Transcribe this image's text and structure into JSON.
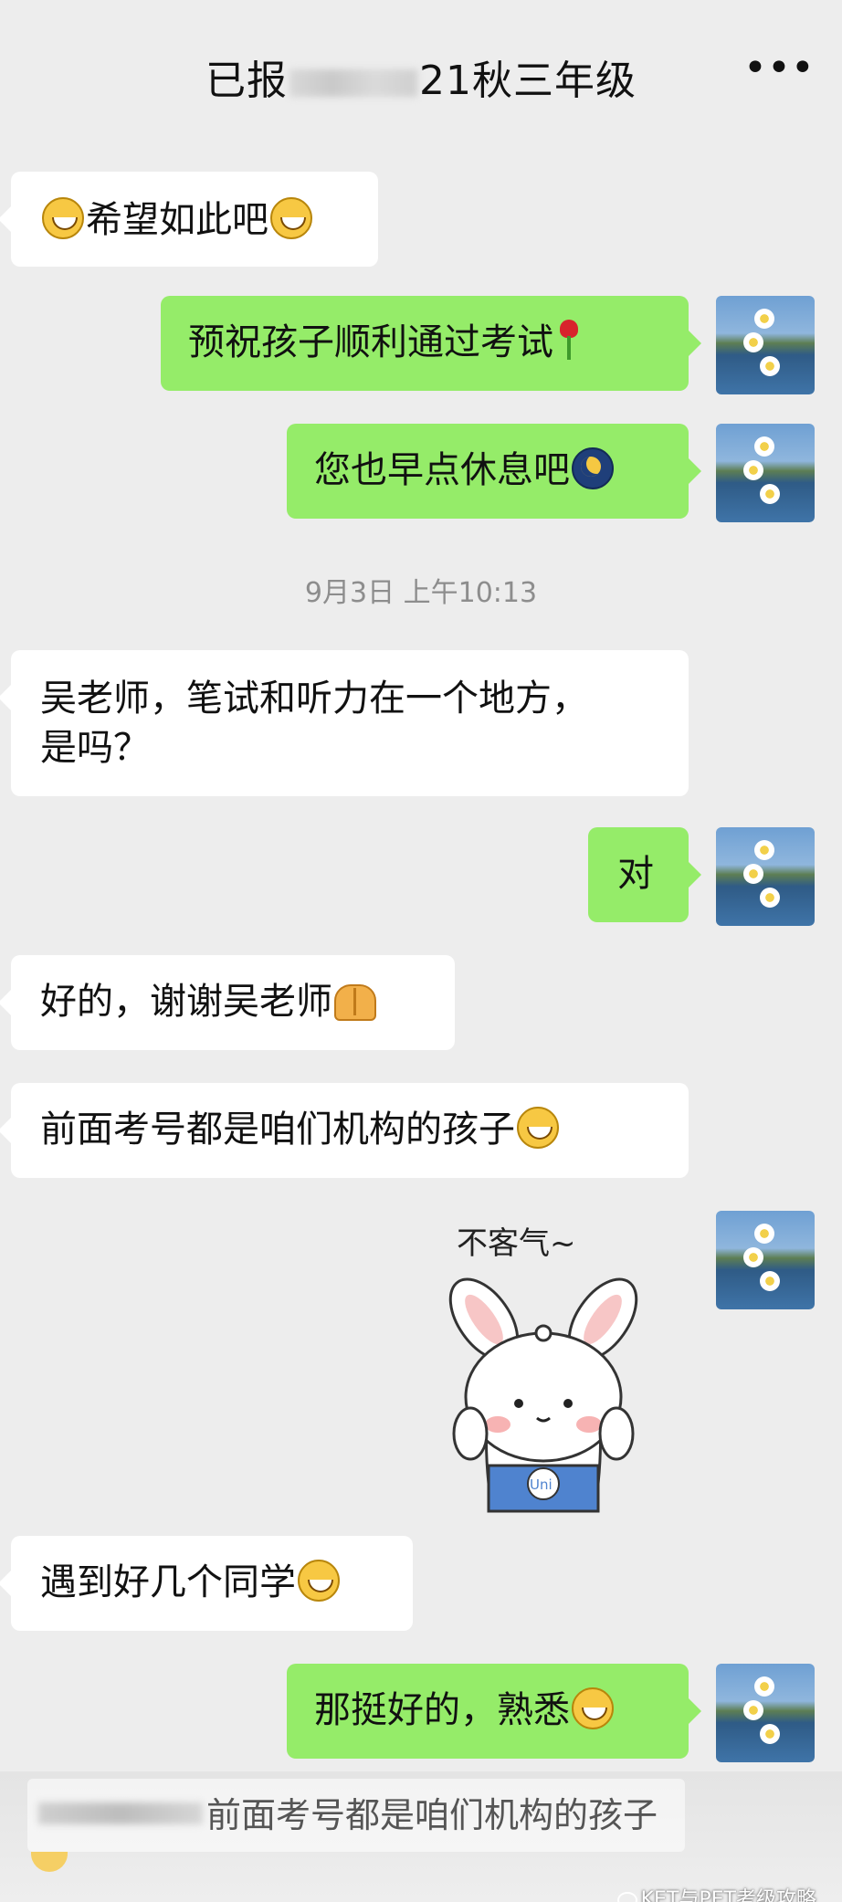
{
  "header": {
    "title_prefix": "已报",
    "title_suffix": "21秋三年级",
    "more": "•••"
  },
  "messages": [
    {
      "id": "m1",
      "side": "in",
      "text": "希望如此吧"
    },
    {
      "id": "m2",
      "side": "out",
      "text": "预祝孩子顺利通过考试"
    },
    {
      "id": "m3",
      "side": "out",
      "text": "您也早点休息吧"
    },
    {
      "id": "m4",
      "side": "in",
      "text_line1": "吴老师，笔试和听力在一个地方，",
      "text_line2": "是吗？"
    },
    {
      "id": "m5",
      "side": "out",
      "text": "对"
    },
    {
      "id": "m6",
      "side": "in",
      "text": "好的，谢谢吴老师"
    },
    {
      "id": "m7",
      "side": "in",
      "text": "前面考号都是咱们机构的孩子"
    },
    {
      "id": "m9",
      "side": "in",
      "text": "遇到好几个同学"
    },
    {
      "id": "m10",
      "side": "out",
      "text": "那挺好的，熟悉"
    }
  ],
  "timestamp": "9月3日 上午10:13",
  "sticker": {
    "caption": "不客气~",
    "badge": "Uni"
  },
  "quote": {
    "text": "前面考号都是咱们机构的孩子"
  },
  "watermark": "KET与PET考级攻略",
  "icons": {
    "emoji_grin": "grinning-face-icon",
    "emoji_rose": "rose-icon",
    "emoji_moon": "crescent-moon-icon",
    "emoji_pray": "folded-hands-icon",
    "more": "more-dots-icon"
  },
  "colors": {
    "background": "#ededed",
    "outgoing_bubble": "#95ec69",
    "incoming_bubble": "#ffffff",
    "timestamp_text": "#8d8d8d"
  }
}
